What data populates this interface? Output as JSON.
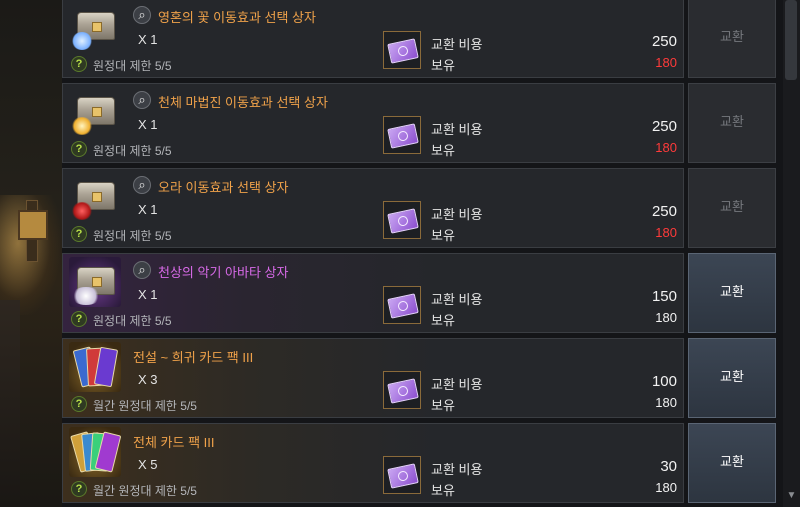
{
  "colors": {
    "item_name_default": "#f0a24a",
    "item_name_epic": "#d86ae8",
    "insufficient": "#ff3a3a"
  },
  "icons": {
    "search": "magnifier-icon",
    "help": "question-mark-icon",
    "currency": "ticket-icon"
  },
  "items": [
    {
      "name": "영혼의 꽃 이동효과 선택 상자",
      "quantity": "X 1",
      "limit": "원정대 제한 5/5",
      "cost_label": "교환 비용",
      "cost": "250",
      "owned_label": "보유",
      "owned": "180",
      "button": "교환",
      "button_enabled": false
    },
    {
      "name": "천체 마법진 이동효과 선택 상자",
      "quantity": "X 1",
      "limit": "원정대 제한 5/5",
      "cost_label": "교환 비용",
      "cost": "250",
      "owned_label": "보유",
      "owned": "180",
      "button": "교환",
      "button_enabled": false
    },
    {
      "name": "오라 이동효과 선택 상자",
      "quantity": "X 1",
      "limit": "원정대 제한 5/5",
      "cost_label": "교환 비용",
      "cost": "250",
      "owned_label": "보유",
      "owned": "180",
      "button": "교환",
      "button_enabled": false
    },
    {
      "name": "천상의 악기 아바타 상자",
      "quantity": "X 1",
      "limit": "원정대 제한 5/5",
      "cost_label": "교환 비용",
      "cost": "150",
      "owned_label": "보유",
      "owned": "180",
      "button": "교환",
      "button_enabled": true
    },
    {
      "name": "전설 ~ 희귀 카드 팩 III",
      "quantity": "X 3",
      "limit": "월간 원정대 제한 5/5",
      "cost_label": "교환 비용",
      "cost": "100",
      "owned_label": "보유",
      "owned": "180",
      "button": "교환",
      "button_enabled": true
    },
    {
      "name": "전체 카드 팩 III",
      "quantity": "X 5",
      "limit": "월간 원정대 제한 5/5",
      "cost_label": "교환 비용",
      "cost": "30",
      "owned_label": "보유",
      "owned": "180",
      "button": "교환",
      "button_enabled": true
    }
  ]
}
